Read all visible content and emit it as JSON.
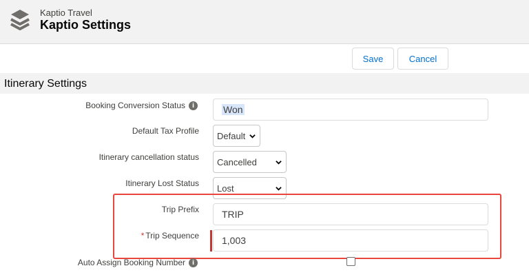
{
  "header": {
    "app_name": "Kaptio Travel",
    "page_title": "Kaptio Settings",
    "icon": "layers-stack-icon"
  },
  "toolbar": {
    "save_label": "Save",
    "cancel_label": "Cancel"
  },
  "section": {
    "title": "Itinerary Settings"
  },
  "fields": {
    "booking_conversion_status": {
      "label": "Booking Conversion Status",
      "value": "Won"
    },
    "default_tax_profile": {
      "label": "Default Tax Profile",
      "value": "Default"
    },
    "itinerary_cancellation_status": {
      "label": "Itinerary cancellation status",
      "value": "Cancelled"
    },
    "itinerary_lost_status": {
      "label": "Itinerary Lost Status",
      "value": "Lost"
    },
    "trip_prefix": {
      "label": "Trip Prefix",
      "value": "TRIP"
    },
    "trip_sequence": {
      "label": "Trip Sequence",
      "required_mark": "*",
      "value": "1,003"
    },
    "auto_assign_booking_number": {
      "label": "Auto Assign Booking Number",
      "checked": false
    }
  },
  "colors": {
    "link_blue": "#0070d2",
    "highlight_red": "#e8453c",
    "error_red": "#c23934"
  }
}
